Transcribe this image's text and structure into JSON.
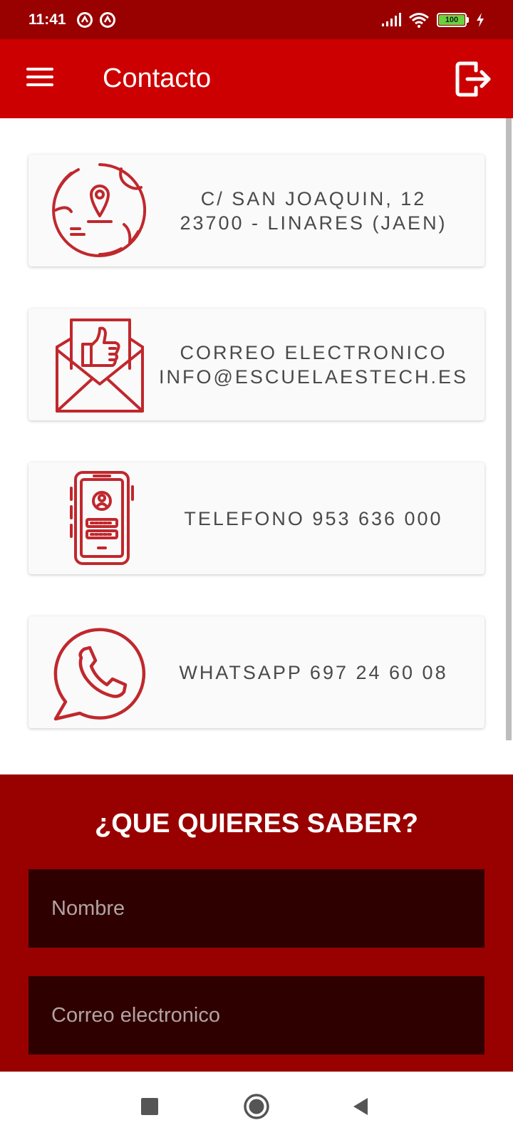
{
  "status_bar": {
    "time": "11:41",
    "battery_level": "100"
  },
  "app_bar": {
    "title": "Contacto"
  },
  "contact_cards": [
    {
      "icon": "map-location-icon",
      "lines": [
        "C/ SAN JOAQUIN, 12",
        "23700 - LINARES (JAEN)"
      ]
    },
    {
      "icon": "mail-thumbs-up-icon",
      "lines": [
        "CORREO ELECTRONICO",
        "INFO@ESCUELAESTECH.ES"
      ]
    },
    {
      "icon": "phone-login-icon",
      "lines": [
        "TELEFONO 953 636 000"
      ]
    },
    {
      "icon": "whatsapp-icon",
      "lines": [
        "WHATSAPP 697 24 60 08"
      ]
    }
  ],
  "form": {
    "title": "¿QUE QUIERES SABER?",
    "name_placeholder": "Nombre",
    "email_placeholder": "Correo electronico"
  },
  "colors": {
    "status_bar": "#990000",
    "app_bar": "#cc0000",
    "form_bg": "#990000",
    "input_bg": "#2e0000",
    "icon_red": "#c0282d"
  }
}
